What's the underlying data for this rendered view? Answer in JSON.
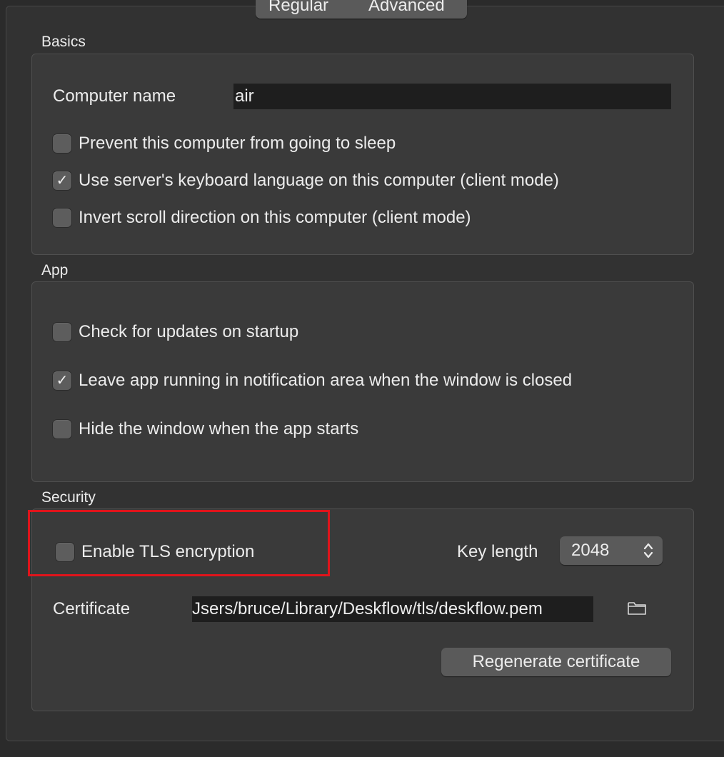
{
  "tabs": {
    "regular": "Regular",
    "advanced": "Advanced"
  },
  "basics": {
    "title": "Basics",
    "computer_name_label": "Computer name",
    "computer_name_value": "air",
    "prevent_sleep": {
      "label": "Prevent this computer from going to sleep",
      "checked": false
    },
    "use_server_keyboard": {
      "label": "Use server's keyboard language on this computer (client mode)",
      "checked": true
    },
    "invert_scroll": {
      "label": "Invert scroll direction on this computer (client mode)",
      "checked": false
    }
  },
  "app": {
    "title": "App",
    "check_updates": {
      "label": "Check for updates on startup",
      "checked": false
    },
    "leave_running": {
      "label": "Leave app running in notification area when the window is closed",
      "checked": true
    },
    "hide_window": {
      "label": "Hide the window when the app starts",
      "checked": false
    }
  },
  "security": {
    "title": "Security",
    "enable_tls": {
      "label": "Enable TLS encryption",
      "checked": false
    },
    "key_length_label": "Key length",
    "key_length_value": "2048",
    "certificate_label": "Certificate",
    "certificate_value": "Jsers/bruce/Library/Deskflow/tls/deskflow.pem",
    "regenerate_button": "Regenerate certificate"
  },
  "checkmark_glyph": "✓",
  "icons": {
    "folder": "folder-icon",
    "select_arrows": "chevron-up-down-icon"
  },
  "colors": {
    "background": "#2b2b2b",
    "panel": "#323232",
    "group_box": "#3a3a3a",
    "control": "#5a5a5a",
    "highlight": "#e0141b"
  }
}
